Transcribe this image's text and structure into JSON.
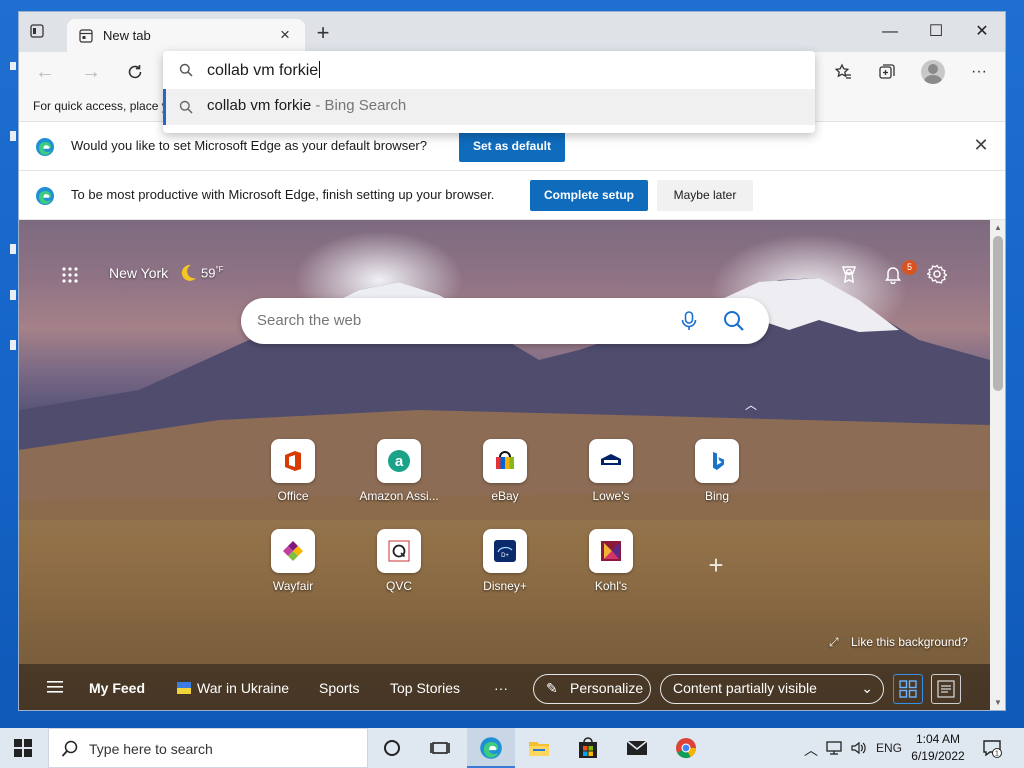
{
  "browser": {
    "tab": {
      "label": "New tab"
    },
    "address": {
      "value": "collab vm forkie"
    },
    "suggestion": {
      "query": "collab vm forkie",
      "suffix": " - Bing Search"
    },
    "favbar": {
      "text": "For quick access, place y"
    },
    "window_controls": {
      "minimize": "—",
      "maximize": "☐",
      "close": "✕"
    }
  },
  "infobars": {
    "default": {
      "message": "Would you like to set Microsoft Edge as your default browser?",
      "button": "Set as default"
    },
    "setup": {
      "message": "To be most productive with Microsoft Edge, finish setting up your browser.",
      "primary": "Complete setup",
      "secondary": "Maybe later"
    }
  },
  "ntp": {
    "weather": {
      "city": "New York",
      "temp": "59",
      "unit": "°F"
    },
    "notifications_badge": "5",
    "search_placeholder": "Search the web",
    "tiles_row1": [
      {
        "label": "Office",
        "icon": "office-icon"
      },
      {
        "label": "Amazon Assi...",
        "icon": "amazon-icon"
      },
      {
        "label": "eBay",
        "icon": "ebay-icon"
      },
      {
        "label": "Lowe's",
        "icon": "lowes-icon"
      },
      {
        "label": "Bing",
        "icon": "bing-icon"
      }
    ],
    "tiles_row2": [
      {
        "label": "Wayfair",
        "icon": "wayfair-icon"
      },
      {
        "label": "QVC",
        "icon": "qvc-icon"
      },
      {
        "label": "Disney+",
        "icon": "disney-icon"
      },
      {
        "label": "Kohl's",
        "icon": "kohls-icon"
      }
    ],
    "like_background": "Like this background?",
    "feed": {
      "my_feed": "My Feed",
      "war": "War in Ukraine",
      "sports": "Sports",
      "top_stories": "Top Stories",
      "more": "···",
      "personalize": "Personalize",
      "content": "Content partially visible"
    }
  },
  "taskbar": {
    "search_placeholder": "Type here to search",
    "lang": "ENG",
    "time": "1:04 AM",
    "date": "6/19/2022",
    "notif_count": "1"
  },
  "colors": {
    "accent": "#0f6cbd",
    "badge": "#d9531e"
  }
}
